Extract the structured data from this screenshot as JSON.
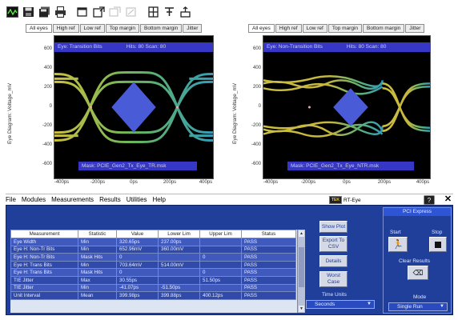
{
  "toolbar": {
    "buttons": [
      {
        "icon": "scope-icon"
      },
      {
        "icon": "save-icon"
      },
      {
        "icon": "save-all-icon"
      },
      {
        "icon": "print-icon"
      },
      {
        "icon": "window-icon"
      },
      {
        "icon": "new-window-icon"
      },
      {
        "icon": "disabled-icon-1"
      },
      {
        "icon": "disabled-icon-2"
      },
      {
        "icon": "grid-icon"
      },
      {
        "icon": "probe-icon"
      },
      {
        "icon": "connect-icon"
      }
    ]
  },
  "panels": {
    "left": {
      "tabs": [
        "All eyes",
        "High ref",
        "Low ref",
        "Top margin",
        "Bottom margin",
        "Jitter"
      ],
      "title_left": "Eye: Transition Bits",
      "title_right": "Hits: 80 Scan: 80",
      "mask": "Mask: PCIE_Gen2_Tx_Eye_TR.msk",
      "ylabel": "Eye Diagram: Voltage_mV",
      "yticks": [
        "600",
        "400",
        "200",
        "0",
        "-200",
        "-400",
        "-600"
      ],
      "xticks": [
        "-400ps",
        "-200ps",
        "0ps",
        "200ps",
        "400ps"
      ]
    },
    "right": {
      "tabs": [
        "All eyes",
        "High ref",
        "Low ref",
        "Top margin",
        "Bottom margin",
        "Jitter"
      ],
      "title_left": "Eye: Non-Transition Bits",
      "title_right": "Hits: 80 Scan: 80",
      "mask": "Mask: PCIE_Gen2_Tx_Eye_NTR.msk",
      "ylabel": "Eye Diagram: Voltage_mV",
      "yticks": [
        "600",
        "400",
        "200",
        "0",
        "-200",
        "-400",
        "-600"
      ],
      "xticks": [
        "-400ps",
        "-200ps",
        "0ps",
        "200ps",
        "400ps"
      ]
    }
  },
  "menubar": {
    "items": [
      "File",
      "Modules",
      "Measurements",
      "Results",
      "Utilities",
      "Help"
    ],
    "underline": [
      "F",
      "o",
      "M",
      "R",
      "U",
      "H"
    ],
    "app_name": "RT-Eye",
    "logo_text": "TEK"
  },
  "results": {
    "columns": [
      "Measurement",
      "Statistic",
      "Value",
      "Lower Lim",
      "Upper Lim",
      "Status"
    ],
    "rows": [
      [
        "Eye Width",
        "Min",
        "320.65ps",
        "237.00ps",
        "",
        "PASS"
      ],
      [
        "Eye H: Non-Tr Bits",
        "Min",
        "652.96mV",
        "360.00mV",
        "",
        "PASS"
      ],
      [
        "Eye H: Non-Tr Bits",
        "Mask Hits",
        "0",
        "",
        "0",
        "PASS"
      ],
      [
        "Eye H: Trans Bits",
        "Min",
        "703.64mV",
        "514.00mV",
        "",
        "PASS"
      ],
      [
        "Eye H: Trans Bits",
        "Mask Hits",
        "0",
        "",
        "0",
        "PASS"
      ],
      [
        "TIE Jitter",
        "Max",
        "30.55ps",
        "",
        "51.50ps",
        "PASS"
      ],
      [
        "TIE Jitter",
        "Min",
        "-41.07ps",
        "-51.50ps",
        "",
        "PASS"
      ],
      [
        "Unit Interval",
        "Mean",
        "399.98ps",
        "399.88ps",
        "400.12ps",
        "PASS"
      ]
    ]
  },
  "controls": {
    "show_plot": "Show Plot",
    "export": "Export To CSV",
    "details": "Details",
    "word_case": "Worst Case",
    "time_units_label": "Time Units",
    "time_units_value": "Seconds"
  },
  "pci": {
    "title": "PCI Express",
    "start_label": "Start",
    "stop_label": "Stop",
    "clear_label": "Clear Results",
    "mode_label": "Mode",
    "mode_value": "Single Run"
  }
}
